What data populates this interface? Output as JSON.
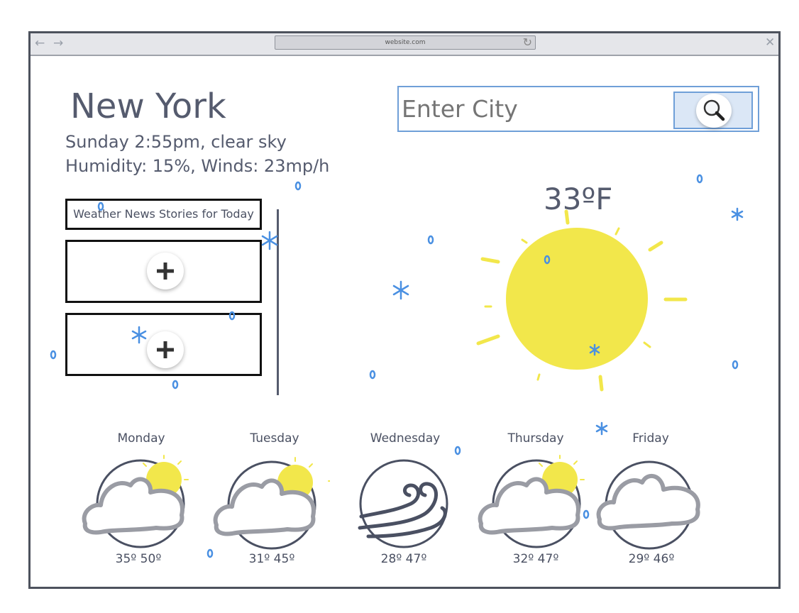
{
  "browser": {
    "url": "website.com",
    "back_glyph": "←",
    "forward_glyph": "→",
    "close_glyph": "✕",
    "reload_glyph": "↻"
  },
  "location": {
    "city": "New York",
    "conditions_line": "Sunday 2:55pm, clear sky",
    "details_line": "Humidity: 15%, Winds: 23mp/h"
  },
  "search": {
    "placeholder": "Enter City",
    "button_icon": "magnifier-icon"
  },
  "news": {
    "title": "Weather News Stories for Today",
    "add_icon": "plus-icon"
  },
  "current": {
    "temperature": "33ºF",
    "icon": "sun-icon"
  },
  "forecast": [
    {
      "day": "Monday",
      "temps": "35º  50º",
      "icon": "partly-cloudy-icon"
    },
    {
      "day": "Tuesday",
      "temps": "31º  45º",
      "icon": "partly-cloudy-icon"
    },
    {
      "day": "Wednesday",
      "temps": "28º  47º",
      "icon": "wind-icon"
    },
    {
      "day": "Thursday",
      "temps": "32º  47º",
      "icon": "partly-cloudy-icon"
    },
    {
      "day": "Friday",
      "temps": "29º  46º",
      "icon": "cloudy-icon"
    }
  ],
  "colors": {
    "sun": "#f2e74b",
    "snow": "#4a90e2",
    "accent": "#6f9fd8",
    "text": "#555b6e"
  }
}
